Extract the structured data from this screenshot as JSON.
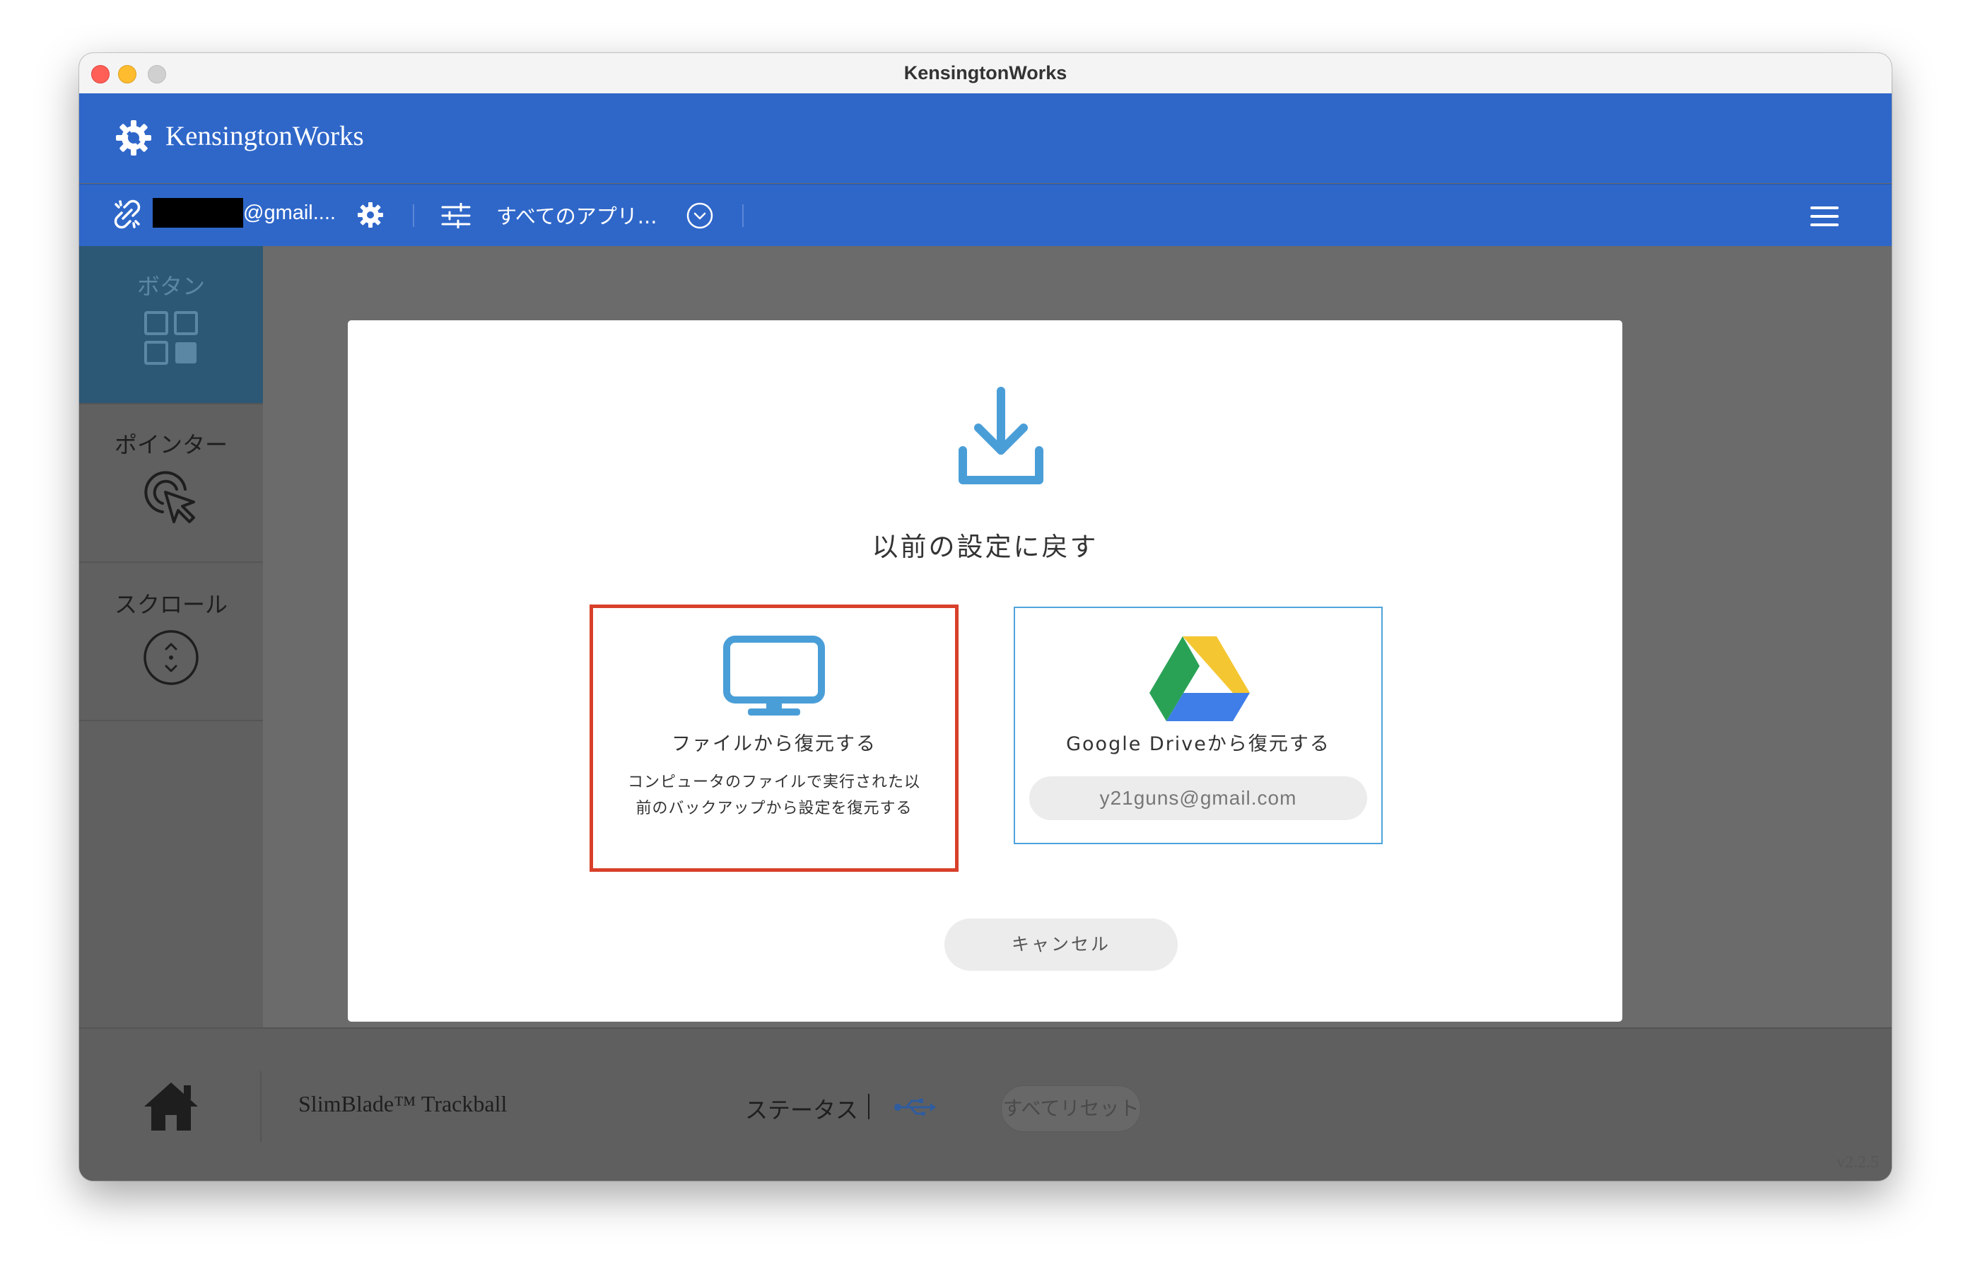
{
  "window": {
    "title": "KensingtonWorks"
  },
  "header": {
    "app_name": "KensingtonWorks"
  },
  "toolbar": {
    "account_suffix": "@gmail....",
    "app_filter_label": "すべてのアプリ..."
  },
  "sidebar": {
    "items": [
      {
        "label": "ボタン",
        "icon": "buttons-grid-icon",
        "active": true
      },
      {
        "label": "ポインター",
        "icon": "pointer-cursor-icon",
        "active": false
      },
      {
        "label": "スクロール",
        "icon": "scroll-icon",
        "active": false
      }
    ]
  },
  "footer": {
    "device_name": "SlimBlade™ Trackball",
    "status_label": "ステータス",
    "reset_label": "すべてリセット",
    "version": "v2.2.5"
  },
  "modal": {
    "title": "以前の設定に戻す",
    "file_option": {
      "title": "ファイルから復元する",
      "description": "コンピュータのファイルで実行された以前のバックアップから設定を復元する"
    },
    "drive_option": {
      "title": "Google Driveから復元する",
      "email": "y21guns@gmail.com"
    },
    "cancel_label": "キャンセル"
  },
  "colors": {
    "header_blue": "#2f67c9",
    "sidebar_active": "#2d5875",
    "icon_blue": "#4a9ed8",
    "highlight_red": "#d8402a"
  }
}
